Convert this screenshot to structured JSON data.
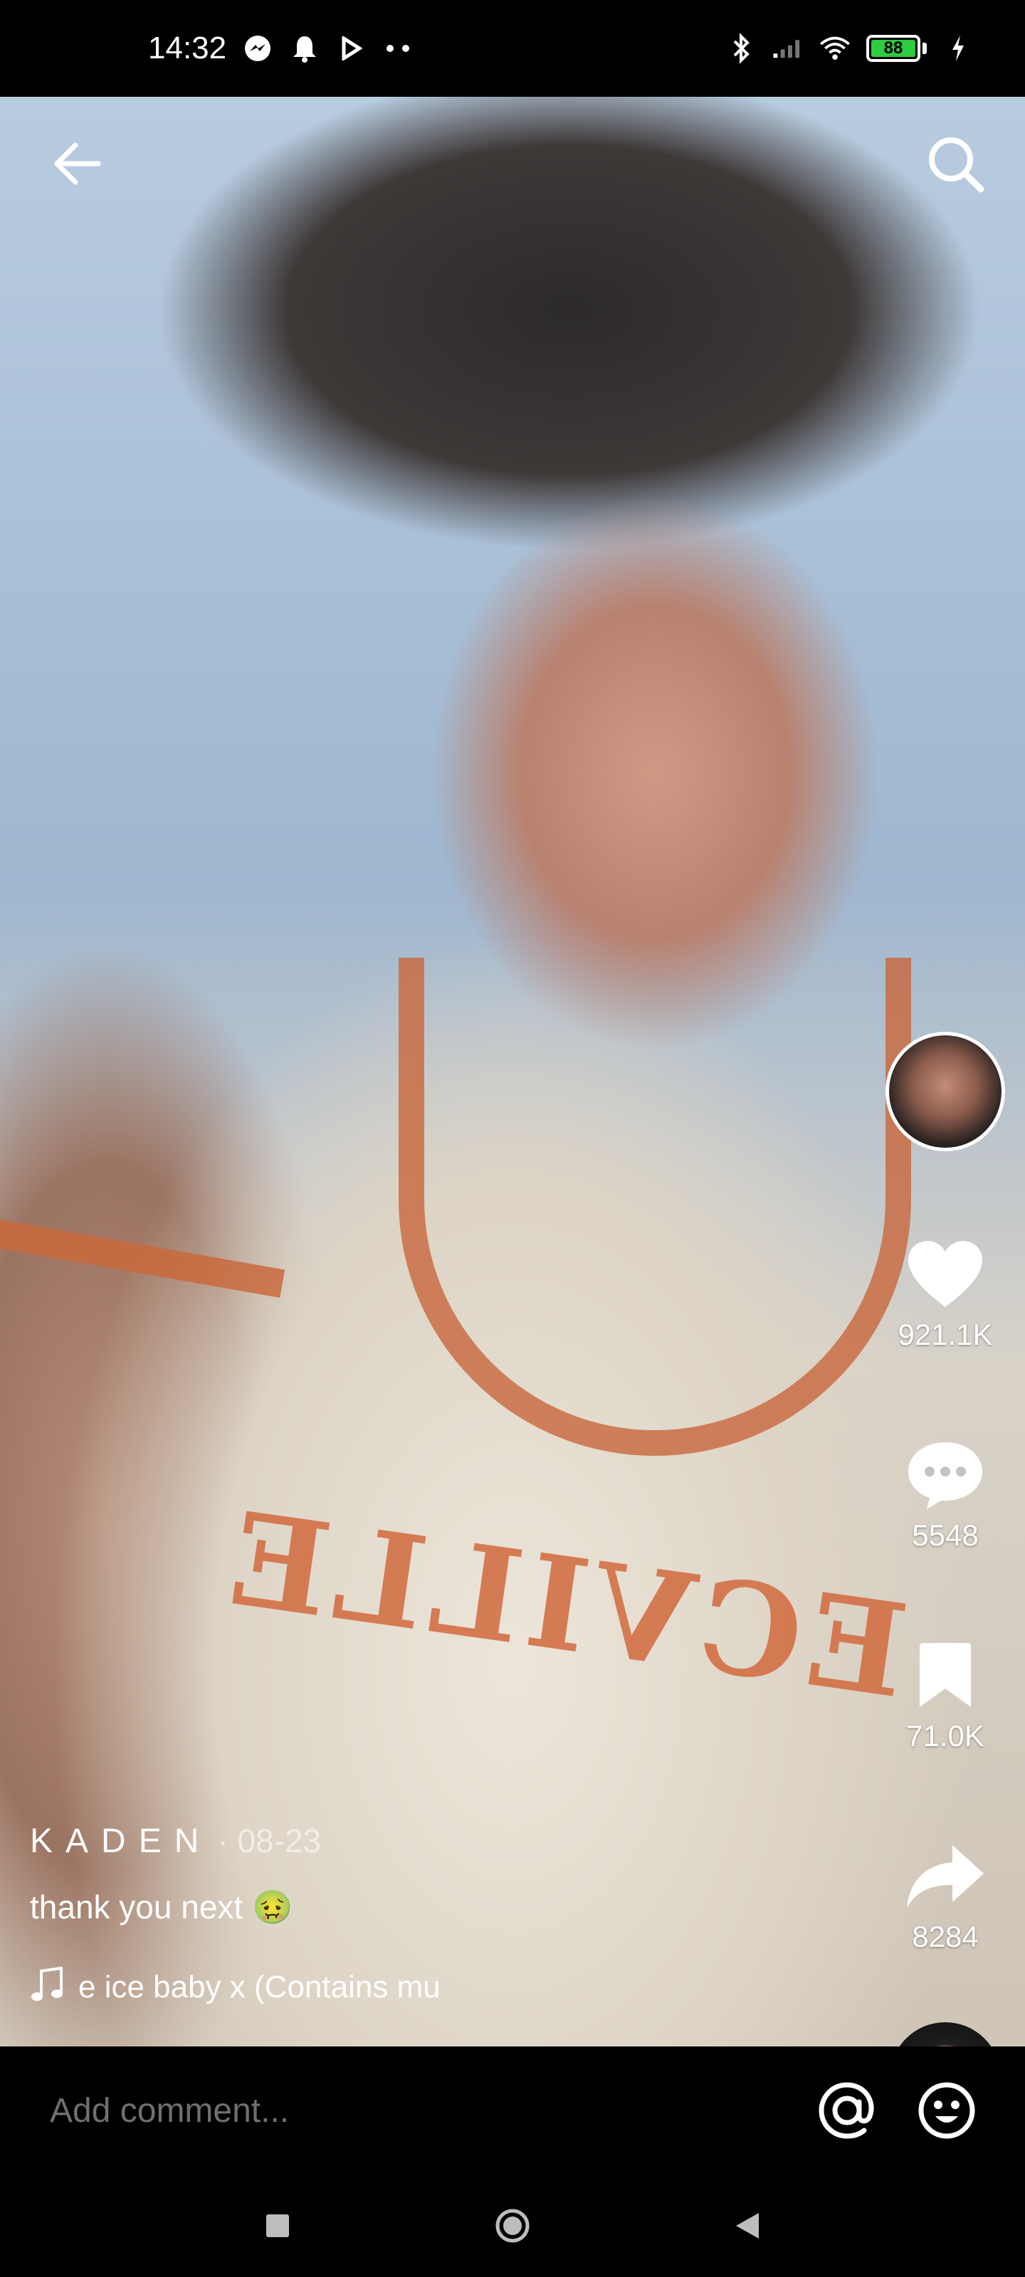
{
  "status_bar": {
    "time": "14:32",
    "battery": "88",
    "battery_color": "#2ecc40",
    "icons_left": [
      "messenger-icon",
      "bell-icon",
      "play-icon",
      "more-dots-icon"
    ],
    "icons_right": [
      "bluetooth-icon",
      "signal-icon",
      "wifi-icon",
      "battery-icon",
      "charging-icon"
    ]
  },
  "header": {
    "back_icon": "arrow-left-icon",
    "search_icon": "search-icon"
  },
  "video": {
    "author": "KADEN",
    "date": "· 08-23",
    "caption": "thank you next 🤢",
    "music": "e ice baby x (Contains mu",
    "shirt_print": "ECVILLE"
  },
  "actions": {
    "likes": "921.1K",
    "comments": "5548",
    "saves": "71.0K",
    "shares": "8284"
  },
  "comment_bar": {
    "placeholder": "Add comment..."
  }
}
